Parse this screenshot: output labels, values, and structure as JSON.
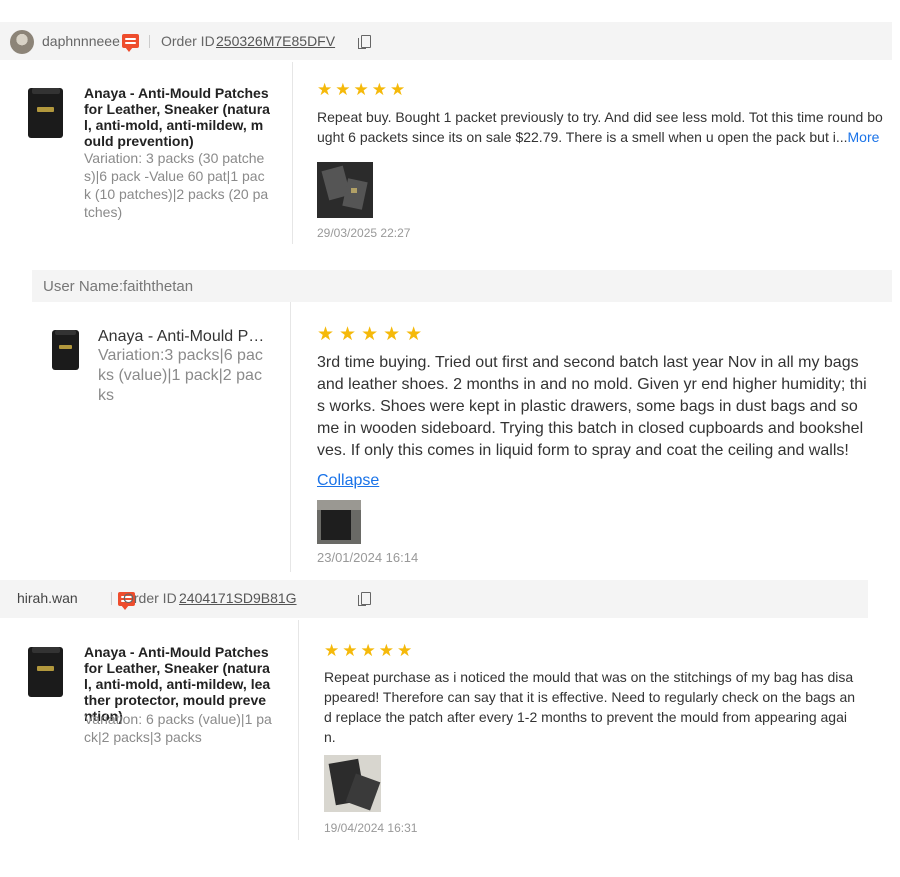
{
  "reviews": [
    {
      "username": "daphnnneee",
      "order_label": "Order ID",
      "order_id": "250326M7E85DFV",
      "product_name": "Anaya - Anti-Mould Patches for Leather, Sneaker (natural, anti-mold, anti-mildew, mould prevention)",
      "variation": "Variation: 3 packs (30 patches)|6 pack -Value 60 pat|1 pack (10 patches)|2 packs (20 patches)",
      "rating": 5,
      "stars": "★★★★★",
      "text": "Repeat buy. Bought 1 packet previously to try. And did see less mold. Tot this time round bought 6 packets since its on sale $22.79. There is a smell when u open the pack but i...",
      "more_label": "More",
      "date": "29/03/2025 22:27"
    },
    {
      "username_label": "User Name:faiththetan",
      "product_name": "Anaya - Anti-Mould Pat...",
      "variation": "Variation:3 packs|6 packs (value)|1 pack|2 packs",
      "rating": 5,
      "stars": "★★★★★",
      "text": "3rd time buying. Tried out first and second batch last year Nov in all my bags and leather shoes. 2 months in and no mold. Given yr end higher humidity; this works. Shoes were kept in plastic drawers, some bags in dust bags and some in wooden sideboard. Trying this batch in closed cupboards and bookshelves. If only this comes in liquid form to spray and coat the ceiling and walls!",
      "collapse_label": "Collapse",
      "date": "23/01/2024 16:14"
    },
    {
      "username": "hirah.wan",
      "order_label": "Order ID",
      "order_id": "2404171SD9B81G",
      "product_name": "Anaya - Anti-Mould Patches for Leather, Sneaker (natural, anti-mold, anti-mildew, leather protector, mould prevention)",
      "variation": "Variation: 6 packs (value)|1 pack|2 packs|3 packs",
      "rating": 5,
      "stars": "★★★★★",
      "text": "Repeat purchase as i noticed the mould that was on the stitchings of my bag has disappeared! Therefore can say that it is effective. Need to regularly check on the bags and replace the patch after every 1-2 months to prevent the mould from appearing again.",
      "date": "19/04/2024 16:31"
    }
  ],
  "colors": {
    "star": "#f5b90a",
    "link": "#1a73e8",
    "chat_badge": "#ee4d2d"
  }
}
